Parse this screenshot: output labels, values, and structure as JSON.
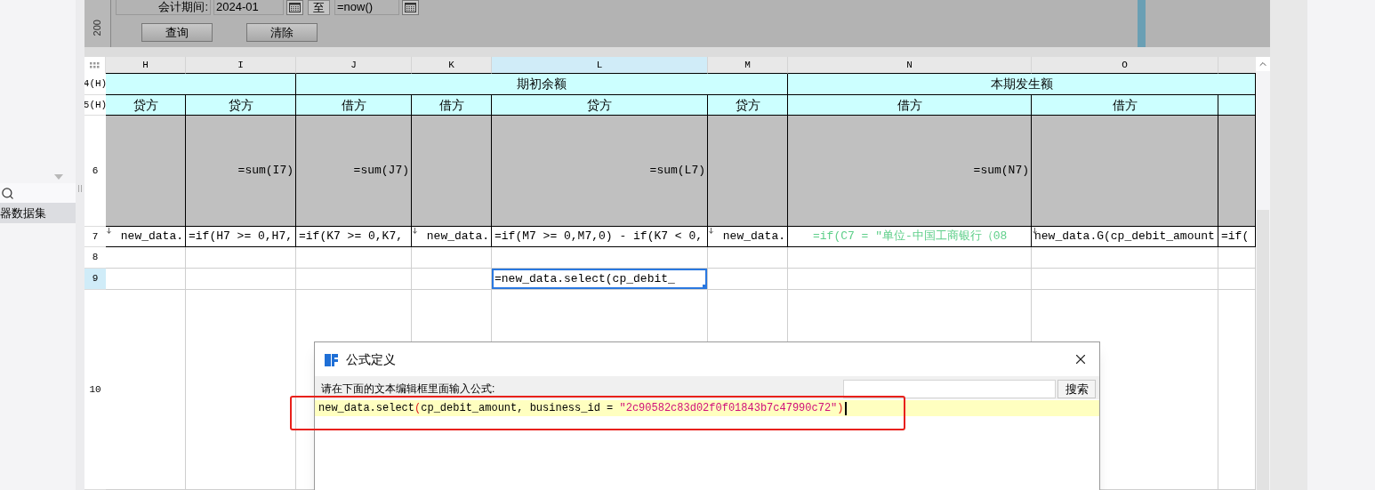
{
  "sidebar": {
    "items": [
      {
        "label": "器数据集",
        "selected": true
      }
    ]
  },
  "query_panel": {
    "ruler_label": "200",
    "period_label": "会计期间:",
    "start_value": "2024-01",
    "to_label": "至",
    "end_value": "=now()",
    "buttons": [
      "查询",
      "清除"
    ]
  },
  "sheet": {
    "columns": [
      {
        "label": "H",
        "selected": false
      },
      {
        "label": "I",
        "selected": false
      },
      {
        "label": "J",
        "selected": false
      },
      {
        "label": "K",
        "selected": false
      },
      {
        "label": "L",
        "selected": true
      },
      {
        "label": "M",
        "selected": false
      },
      {
        "label": "N",
        "selected": false
      },
      {
        "label": "O",
        "selected": false
      }
    ],
    "rows": [
      {
        "label": "4(H)",
        "selected": false,
        "cells": [
          {
            "kind": "header"
          },
          {
            "kind": "header",
            "text": "期初余额"
          },
          {
            "kind": "header",
            "text": "本期发生额"
          }
        ]
      },
      {
        "label": "5(H)",
        "selected": false,
        "cells": [
          {
            "kind": "header",
            "text": "贷方"
          },
          {
            "kind": "header",
            "text": "贷方"
          },
          {
            "kind": "header",
            "text": "借方"
          },
          {
            "kind": "header",
            "text": "借方"
          },
          {
            "kind": "header",
            "text": "贷方"
          },
          {
            "kind": "header",
            "text": "贷方"
          },
          {
            "kind": "header",
            "text": "借方"
          },
          {
            "kind": "header",
            "text": "借方"
          },
          {
            "kind": "header"
          }
        ]
      },
      {
        "label": "6",
        "selected": false,
        "cells": [
          {
            "kind": "total"
          },
          {
            "kind": "total",
            "text": "=sum(I7)"
          },
          {
            "kind": "total",
            "text": "=sum(J7)"
          },
          {
            "kind": "total"
          },
          {
            "kind": "total",
            "text": "=sum(L7)"
          },
          {
            "kind": "total"
          },
          {
            "kind": "total",
            "text": "=sum(N7)"
          },
          {
            "kind": "total"
          },
          {
            "kind": "total"
          }
        ]
      },
      {
        "label": "7",
        "selected": false,
        "cells": [
          {
            "kind": "formula",
            "text": "new_data.",
            "marker": true
          },
          {
            "kind": "formula",
            "text": "=if(H7 >= 0,H7,",
            "marker": false
          },
          {
            "kind": "formula",
            "text": "=if(K7 >= 0,K7,",
            "marker": false
          },
          {
            "kind": "formula",
            "text": "new_data.",
            "marker": true
          },
          {
            "kind": "formula",
            "text": "=if(M7 >= 0,M7,0) - if(K7 < 0,",
            "marker": false
          },
          {
            "kind": "formula",
            "text": "new_data.",
            "marker": true
          },
          {
            "kind": "conditional",
            "text": "=if(C7 = \"单位-中国工商银行（08",
            "marker": false
          },
          {
            "kind": "formula",
            "text": "new_data.G(cp_debit_amount",
            "marker": true
          },
          {
            "kind": "formula",
            "text": "=if(",
            "marker": false
          }
        ]
      },
      {
        "label": "8",
        "selected": false,
        "cells": [
          {
            "kind": "blank"
          },
          {
            "kind": "blank"
          },
          {
            "kind": "blank"
          },
          {
            "kind": "blank"
          },
          {
            "kind": "blank"
          },
          {
            "kind": "blank"
          },
          {
            "kind": "blank"
          },
          {
            "kind": "blank"
          },
          {
            "kind": "blank"
          }
        ]
      },
      {
        "label": "9",
        "selected": true,
        "cells": [
          {
            "kind": "blank"
          },
          {
            "kind": "blank"
          },
          {
            "kind": "blank"
          },
          {
            "kind": "blank"
          },
          {
            "kind": "editing",
            "text": "=new_data.select(cp_debit_"
          },
          {
            "kind": "blank"
          },
          {
            "kind": "blank"
          },
          {
            "kind": "blank"
          },
          {
            "kind": "blank"
          }
        ]
      },
      {
        "label": "10",
        "selected": false,
        "cells": [
          {
            "kind": "blank"
          },
          {
            "kind": "blank"
          },
          {
            "kind": "blank"
          },
          {
            "kind": "blank"
          },
          {
            "kind": "blank"
          },
          {
            "kind": "blank"
          },
          {
            "kind": "blank"
          },
          {
            "kind": "blank"
          },
          {
            "kind": "blank"
          }
        ]
      }
    ]
  },
  "dialog": {
    "title": "公式定义",
    "prompt": "请在下面的文本编辑框里面输入公式:",
    "search_button": "搜索",
    "formula": [
      {
        "kind": "plain",
        "text": "new_data.select"
      },
      {
        "kind": "paren",
        "text": "("
      },
      {
        "kind": "plain",
        "text": "cp_debit_amount, business_id = "
      },
      {
        "kind": "string",
        "text": "\"2c90582c83d02f0f01843b7c47990c72\""
      },
      {
        "kind": "paren",
        "text": ")"
      }
    ]
  }
}
